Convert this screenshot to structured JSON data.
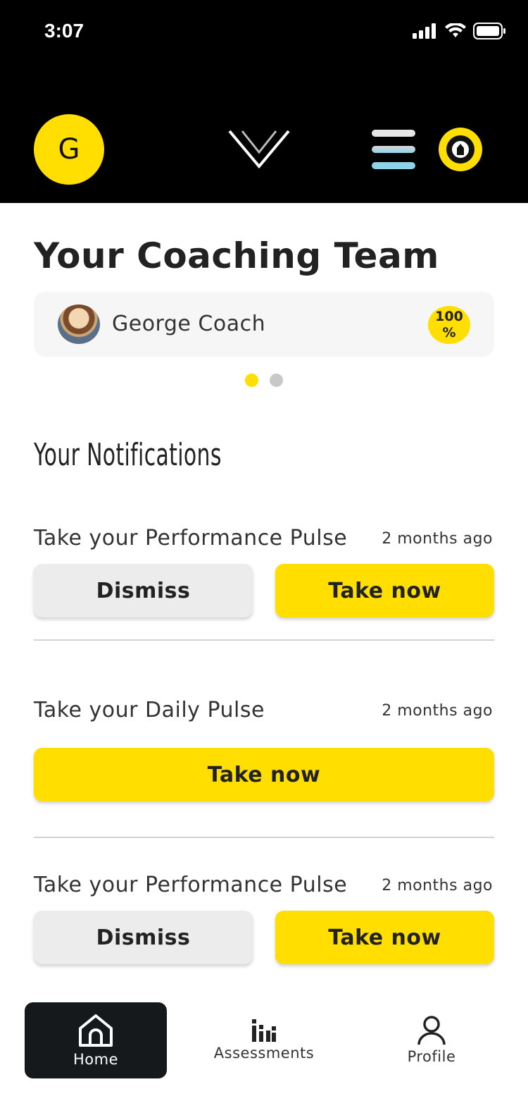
{
  "status_bar": {
    "time": "3:07"
  },
  "header": {
    "avatar_initial": "G",
    "logo_icon": "v-logo-icon",
    "menu_icon": "hamburger-menu-icon",
    "badge_icon": "aq-type-warrior-badge"
  },
  "coaching": {
    "title": "Your Coaching Team",
    "coach_name": "George Coach",
    "progress_label": "100\n%",
    "progress_value": 100,
    "pager": {
      "count": 2,
      "active_index": 0
    }
  },
  "notifications": {
    "title": "Your Notifications",
    "items": [
      {
        "text": "Take your Performance Pulse",
        "time": "2 months ago",
        "dismiss_label": "Dismiss",
        "action_label": "Take now"
      },
      {
        "text": "Take your Daily Pulse",
        "time": "2 months ago",
        "action_label": "Take now"
      },
      {
        "text": "Take your Performance Pulse",
        "time": "2 months ago",
        "dismiss_label": "Dismiss",
        "action_label": "Take now"
      }
    ]
  },
  "tabbar": {
    "items": [
      {
        "label": "Home",
        "icon": "home-icon",
        "active": true
      },
      {
        "label": "Assessments",
        "icon": "bar-chart-icon",
        "active": false
      },
      {
        "label": "Profile",
        "icon": "person-icon",
        "active": false
      }
    ]
  },
  "colors": {
    "accent": "#FFDE00",
    "header_bg": "#000000",
    "menu_top": "#E6E6E6",
    "menu_bottom": "#8FD3E8",
    "active_tab_bg": "#16191C",
    "dot_inactive": "#C8C8C8"
  }
}
